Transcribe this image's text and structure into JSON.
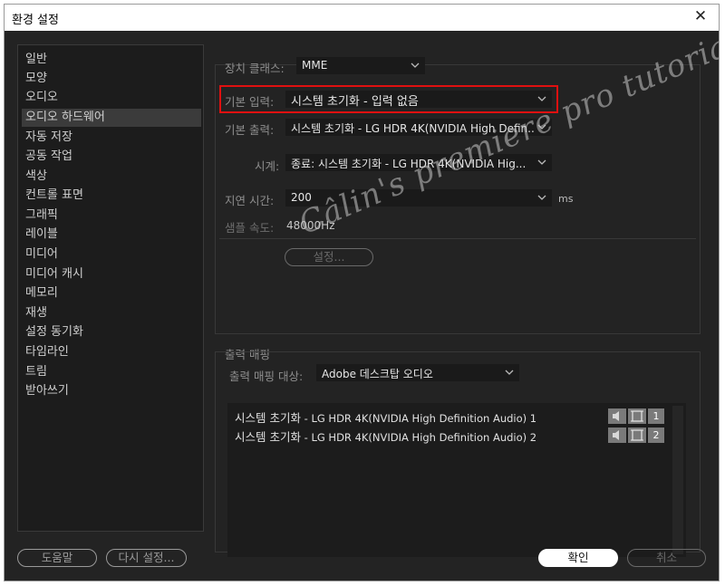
{
  "window": {
    "title": "환경 설정"
  },
  "sidebar": {
    "items": [
      {
        "label": "일반"
      },
      {
        "label": "모양"
      },
      {
        "label": "오디오"
      },
      {
        "label": "오디오 하드웨어",
        "selected": true
      },
      {
        "label": "자동 저장"
      },
      {
        "label": "공동 작업"
      },
      {
        "label": "색상"
      },
      {
        "label": "컨트롤 표면"
      },
      {
        "label": "그래픽"
      },
      {
        "label": "레이블"
      },
      {
        "label": "미디어"
      },
      {
        "label": "미디어 캐시"
      },
      {
        "label": "메모리"
      },
      {
        "label": "재생"
      },
      {
        "label": "설정 동기화"
      },
      {
        "label": "타임라인"
      },
      {
        "label": "트림"
      },
      {
        "label": "받아쓰기"
      }
    ]
  },
  "hardware": {
    "device_class_label": "장치 클래스:",
    "device_class_value": "MME",
    "default_input_label": "기본 입력:",
    "default_input_value": "시스템 초기화 - 입력 없음",
    "default_output_label": "기본 출력:",
    "default_output_value": "시스템 초기화 - LG HDR 4K(NVIDIA High Defin...",
    "clock_label": "시계:",
    "clock_value": "종료: 시스템 초기화 - LG HDR 4K(NVIDIA Hig...",
    "latency_label": "지연 시간:",
    "latency_value": "200",
    "latency_unit": "ms",
    "sample_rate_label": "샘플 속도:",
    "sample_rate_value": "48000Hz",
    "settings_button": "설정..."
  },
  "output_mapping": {
    "section_label": "출력 매핑",
    "target_label": "출력 매핑 대상:",
    "target_value": "Adobe 데스크탑 오디오",
    "rows": [
      {
        "label": "시스템 초기화",
        "detail": " - LG HDR 4K(NVIDIA High Definition Audio) 1",
        "channel": "1"
      },
      {
        "label": "시스템 초기화",
        "detail": " - LG HDR 4K(NVIDIA High Definition Audio) 2",
        "channel": "2"
      }
    ]
  },
  "footer": {
    "help_button": "도움말",
    "reset_button": "다시 설정...",
    "ok_button": "확인",
    "cancel_button": "취소"
  },
  "watermark": {
    "text": "Câlin's premiere pro tutorial"
  },
  "colors": {
    "highlight": "#e01010",
    "panel_bg": "#232323",
    "sidebar_selected": "#3b3b3b"
  }
}
